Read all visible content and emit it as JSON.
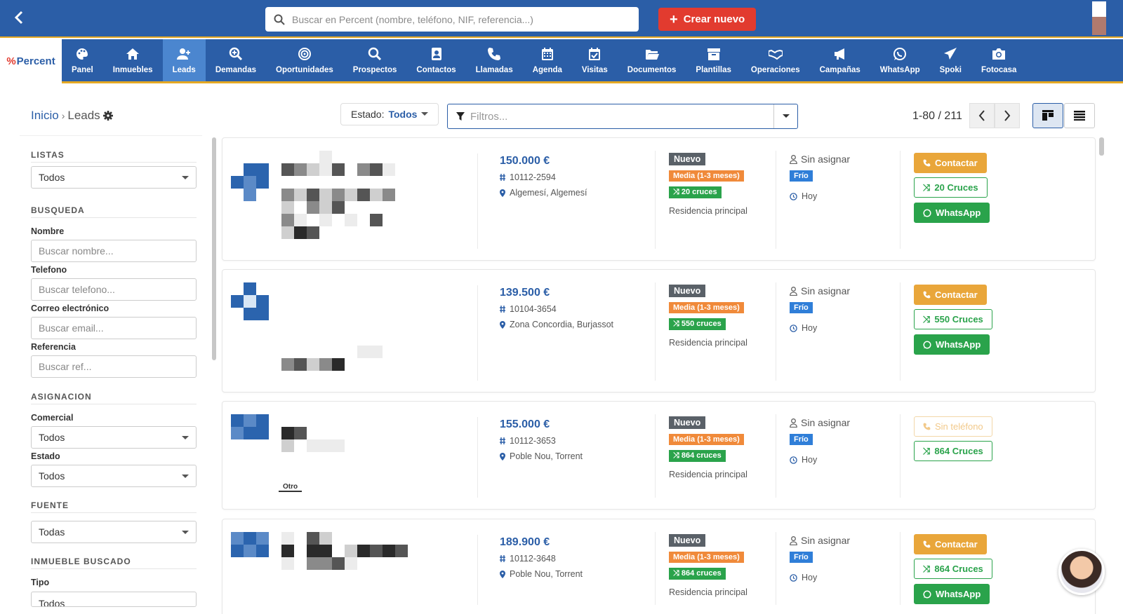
{
  "topbar": {
    "search_placeholder": "Buscar en Percent (nombre, teléfono, NIF, referencia...)",
    "create_label": "Crear nuevo"
  },
  "nav": {
    "logo": "Percent",
    "items": [
      {
        "label": "Panel",
        "icon": "palette-icon"
      },
      {
        "label": "Inmuebles",
        "icon": "home-icon"
      },
      {
        "label": "Leads",
        "icon": "user-plus-icon",
        "active": true
      },
      {
        "label": "Demandas",
        "icon": "search-plus-icon"
      },
      {
        "label": "Oportunidades",
        "icon": "target-icon"
      },
      {
        "label": "Prospectos",
        "icon": "search-icon"
      },
      {
        "label": "Contactos",
        "icon": "contact-book-icon"
      },
      {
        "label": "Llamadas",
        "icon": "phone-icon"
      },
      {
        "label": "Agenda",
        "icon": "calendar-icon"
      },
      {
        "label": "Visitas",
        "icon": "calendar-check-icon"
      },
      {
        "label": "Documentos",
        "icon": "folder-icon"
      },
      {
        "label": "Plantillas",
        "icon": "archive-icon"
      },
      {
        "label": "Operaciones",
        "icon": "handshake-icon"
      },
      {
        "label": "Campañas",
        "icon": "megaphone-icon"
      },
      {
        "label": "WhatsApp",
        "icon": "whatsapp-icon"
      },
      {
        "label": "Spoki",
        "icon": "paper-plane-icon"
      },
      {
        "label": "Fotocasa",
        "icon": "camera-icon"
      }
    ]
  },
  "toolbar": {
    "breadcrumb_home": "Inicio",
    "breadcrumb_sep": "›",
    "breadcrumb_current": "Leads",
    "estado_label": "Estado:",
    "estado_value": "Todos",
    "filters_placeholder": "Filtros...",
    "pager": "1-80 / 211"
  },
  "sidebar": {
    "listas": "LISTAS",
    "listas_value": "Todos",
    "busqueda": "BUSQUEDA",
    "nombre_label": "Nombre",
    "nombre_ph": "Buscar nombre...",
    "telefono_label": "Telefono",
    "telefono_ph": "Buscar telefono...",
    "email_label": "Correo electrónico",
    "email_ph": "Buscar email...",
    "ref_label": "Referencia",
    "ref_ph": "Buscar ref...",
    "asignacion": "ASIGNACION",
    "comercial_label": "Comercial",
    "comercial_value": "Todos",
    "estado_label": "Estado",
    "estado_value": "Todos",
    "fuente": "FUENTE",
    "fuente_value": "Todas",
    "inmueble": "INMUEBLE BUSCADO",
    "tipo_label": "Tipo",
    "tipo_value": "Todos"
  },
  "leads": [
    {
      "price": "150.000 €",
      "ref": "10112-2594",
      "location": "Algemesí, Algemesí",
      "estado": "Nuevo",
      "urgencia": "Media (1-3 meses)",
      "cruces_badge": "20 cruces",
      "tipo": "Residencia principal",
      "asignado": "Sin asignar",
      "temperatura": "Frío",
      "fecha": "Hoy",
      "contact_label": "Contactar",
      "cruces_btn": "20 Cruces",
      "whatsapp": "WhatsApp"
    },
    {
      "price": "139.500 €",
      "ref": "10104-3654",
      "location": "Zona Concordia, Burjassot",
      "estado": "Nuevo",
      "urgencia": "Media (1-3 meses)",
      "cruces_badge": "550 cruces",
      "tipo": "Residencia principal",
      "asignado": "Sin asignar",
      "temperatura": "Frío",
      "fecha": "Hoy",
      "contact_label": "Contactar",
      "cruces_btn": "550 Cruces",
      "whatsapp": "WhatsApp"
    },
    {
      "price": "155.000 €",
      "ref": "10112-3653",
      "location": "Poble Nou, Torrent",
      "estado": "Nuevo",
      "urgencia": "Media (1-3 meses)",
      "cruces_badge": "864 cruces",
      "tipo": "Residencia principal",
      "asignado": "Sin asignar",
      "temperatura": "Frío",
      "fecha": "Hoy",
      "contact_label": "Sin teléfono",
      "cruces_btn": "864 Cruces",
      "whatsapp": "",
      "tag": "Otro"
    },
    {
      "price": "189.900 €",
      "ref": "10112-3648",
      "location": "Poble Nou, Torrent",
      "estado": "Nuevo",
      "urgencia": "Media (1-3 meses)",
      "cruces_badge": "864 cruces",
      "tipo": "Residencia principal",
      "asignado": "Sin asignar",
      "temperatura": "Frío",
      "fecha": "Hoy",
      "contact_label": "Contactar",
      "cruces_btn": "864 Cruces",
      "whatsapp": "WhatsApp"
    }
  ],
  "colors": {
    "primary": "#2b5ea7",
    "accent": "#e5a823",
    "danger": "#e23b2f",
    "success": "#2aa34b",
    "warning": "#f08a3a",
    "contact": "#e9a63a"
  }
}
